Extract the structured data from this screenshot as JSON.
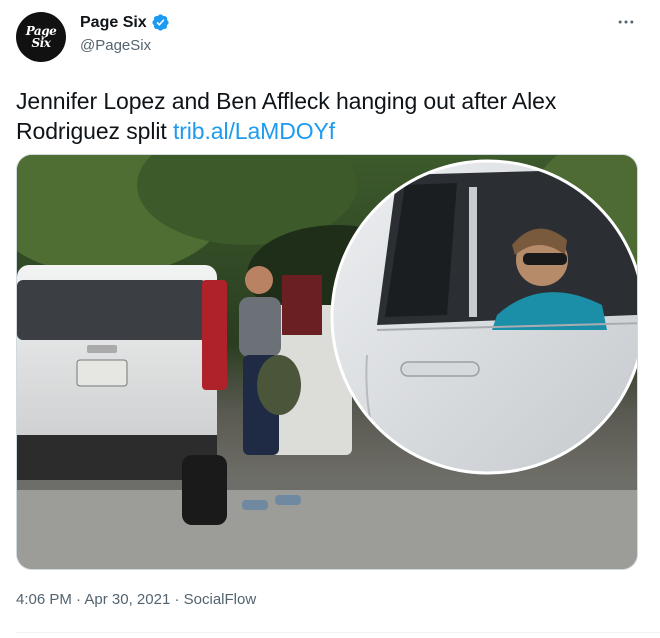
{
  "author": {
    "avatar_text_line1": "Page",
    "avatar_text_line2": "Six",
    "display_name": "Page Six",
    "handle": "@PageSix",
    "verified": true
  },
  "tweet": {
    "text": "Jennifer Lopez and Ben Affleck hanging out after Alex Rodriguez split",
    "link": "trib.al/LaMDOYf",
    "time": "4:06 PM",
    "date": "Apr 30, 2021",
    "separator": "·",
    "source": "SocialFlow"
  },
  "icons": {
    "more": "more-horizontal-icon",
    "verified": "verified-badge-icon"
  },
  "colors": {
    "link": "#1d9bf0",
    "verified": "#1d9bf0",
    "secondary_text": "#536471",
    "border": "#cfd9de"
  }
}
